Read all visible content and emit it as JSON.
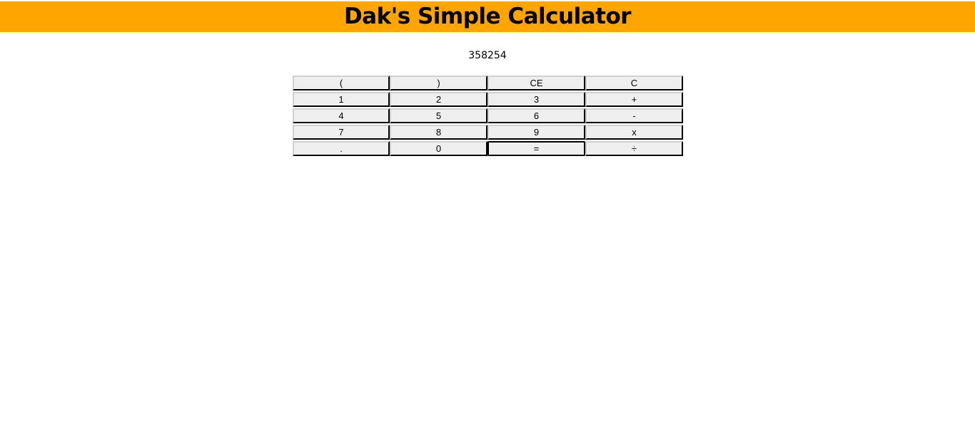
{
  "header": {
    "title": "Dak's Simple Calculator"
  },
  "display": {
    "value": "358254"
  },
  "keypad": {
    "rows": [
      [
        "(",
        ")",
        "CE",
        "C"
      ],
      [
        "1",
        "2",
        "3",
        "+"
      ],
      [
        "4",
        "5",
        "6",
        "-"
      ],
      [
        "7",
        "8",
        "9",
        "x"
      ],
      [
        ".",
        "0",
        "=",
        "÷"
      ]
    ]
  },
  "colors": {
    "header_bg": "#ffa500",
    "button_bg": "#efefef"
  }
}
